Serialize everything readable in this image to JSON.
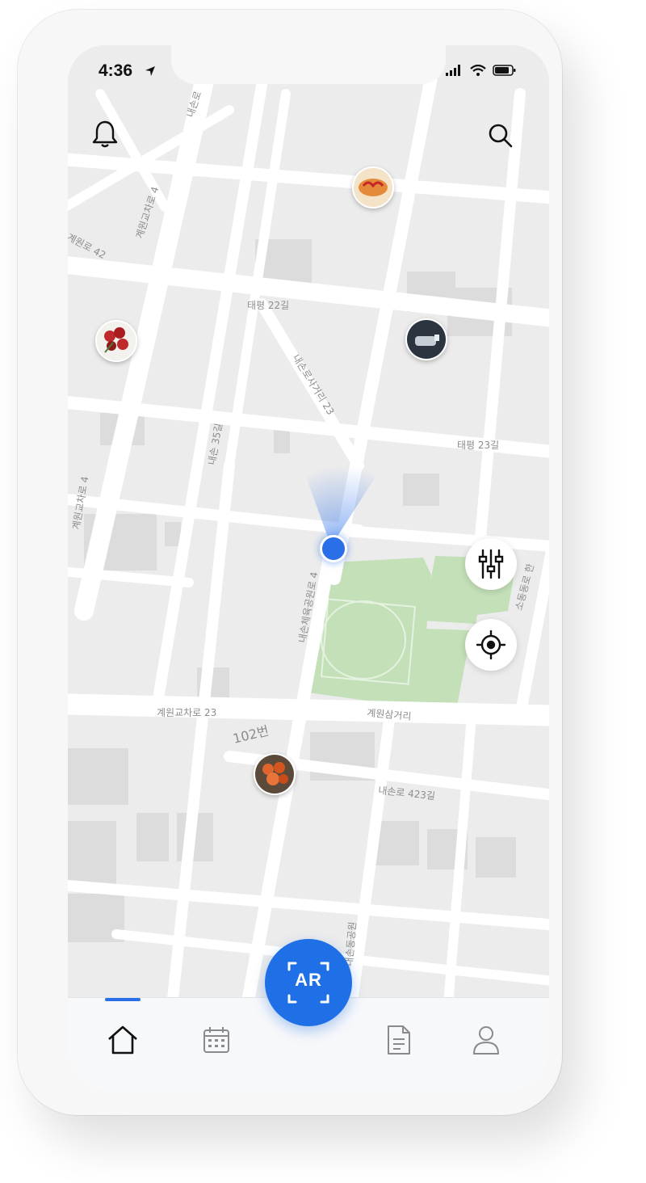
{
  "status_bar": {
    "time": "4:36"
  },
  "map": {
    "road_labels": {
      "r1": "내손로",
      "r2": "계원교차로 4",
      "r3": "계원로 42",
      "r4": "태평 22길",
      "r5": "내손로사거리 23",
      "r6": "내손 35길",
      "r7": "태평 23길",
      "r8": "계원교차로 4",
      "r9": "내손체육공원로 4",
      "r10": "소동동로 한",
      "r11": "계원교차로 23",
      "r12": "계원삼거리",
      "r13": "102번",
      "r14": "내손로 423길",
      "r15": "내손동공원"
    },
    "pins": [
      {
        "name": "pin-bread",
        "color": "#e07a3f"
      },
      {
        "name": "pin-flowers",
        "color": "#c0292b"
      },
      {
        "name": "pin-bottle",
        "color": "#3a4452"
      },
      {
        "name": "pin-snack",
        "color": "#d95a2a"
      }
    ]
  },
  "top_actions": {
    "notification_icon": "bell-icon",
    "search_icon": "search-icon"
  },
  "floating_actions": {
    "filter_icon": "tuning-icon",
    "locate_icon": "crosshair-icon"
  },
  "ar_button": {
    "label": "AR"
  },
  "tabbar": {
    "items": [
      {
        "name": "home",
        "icon": "home-icon",
        "active": true
      },
      {
        "name": "calendar",
        "icon": "calendar-icon",
        "active": false
      },
      {
        "name": "documents",
        "icon": "document-icon",
        "active": false
      },
      {
        "name": "profile",
        "icon": "user-icon",
        "active": false
      }
    ],
    "accent": "#2a6ee8"
  }
}
